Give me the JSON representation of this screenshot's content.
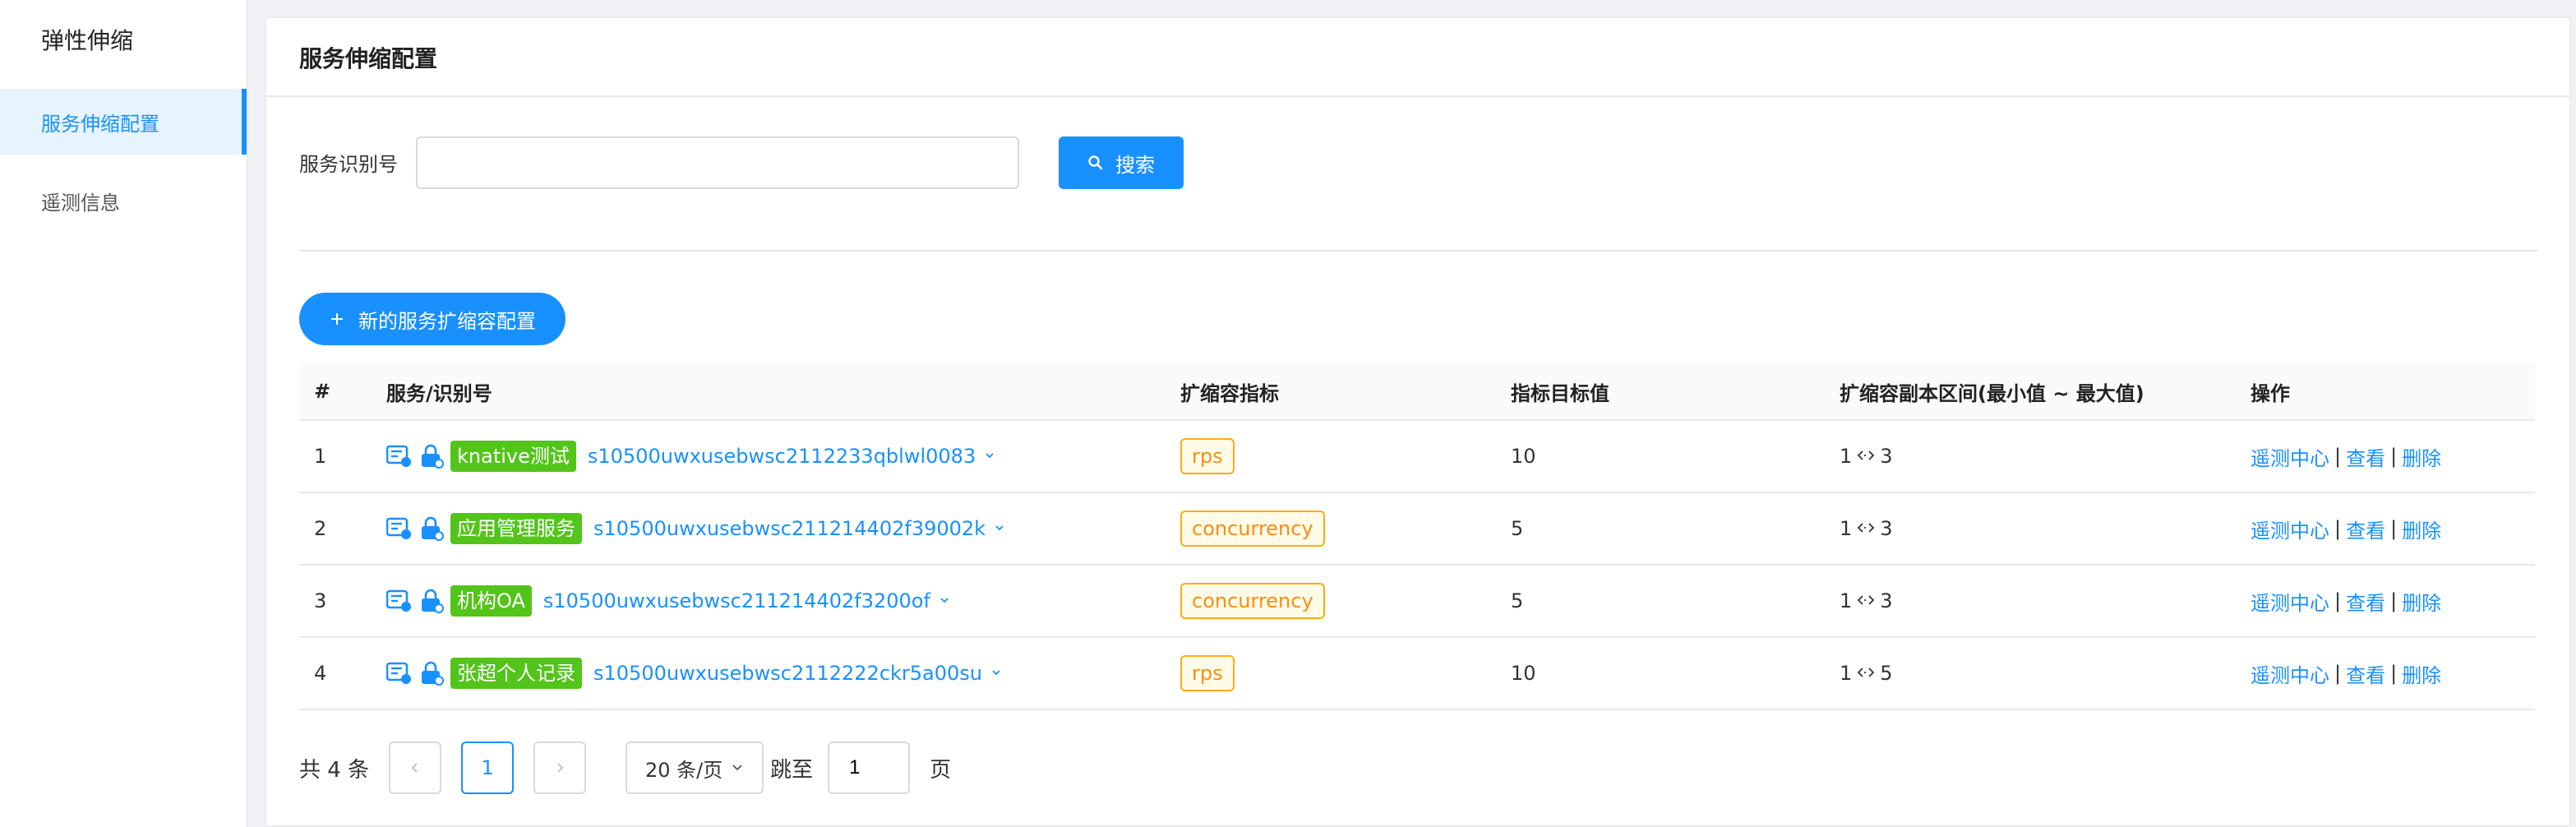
{
  "sidebar": {
    "title": "弹性伸缩",
    "items": [
      {
        "label": "服务伸缩配置",
        "active": true
      },
      {
        "label": "遥测信息",
        "active": false
      }
    ]
  },
  "page": {
    "title": "服务伸缩配置"
  },
  "search": {
    "label": "服务识别号",
    "value": "",
    "button_label": "搜索"
  },
  "actions": {
    "new_button_label": "新的服务扩缩容配置"
  },
  "table": {
    "columns": [
      "#",
      "服务/识别号",
      "扩缩容指标",
      "指标目标值",
      "扩缩容副本区间(最小值 ~ 最大值)",
      "操作"
    ],
    "rows": [
      {
        "index": "1",
        "service_name": "knative测试",
        "service_id": "s10500uwxusebwsc2112233qblwl0083",
        "metric": "rps",
        "target": "10",
        "min": "1",
        "max": "3"
      },
      {
        "index": "2",
        "service_name": "应用管理服务",
        "service_id": "s10500uwxusebwsc211214402f39002k",
        "metric": "concurrency",
        "target": "5",
        "min": "1",
        "max": "3"
      },
      {
        "index": "3",
        "service_name": "机构OA",
        "service_id": "s10500uwxusebwsc211214402f3200of",
        "metric": "concurrency",
        "target": "5",
        "min": "1",
        "max": "3"
      },
      {
        "index": "4",
        "service_name": "张超个人记录",
        "service_id": "s10500uwxusebwsc2112222ckr5a00su",
        "metric": "rps",
        "target": "10",
        "min": "1",
        "max": "5"
      }
    ],
    "ops": {
      "telemetry": "遥测中心",
      "view": "查看",
      "delete": "删除",
      "separator": "|"
    }
  },
  "pagination": {
    "total_text": "共 4 条",
    "current_page": "1",
    "page_size": "20 条/页",
    "jump_label": "跳至",
    "jump_value": "1",
    "jump_unit": "页"
  },
  "colors": {
    "primary": "#1890ff",
    "tag_green": "#52c41a",
    "metric_orange": "#fa8c16"
  },
  "icons": {
    "search": "search-icon",
    "plus": "plus-icon",
    "range": "left-right-arrow-icon",
    "expand": "chevron-down-icon"
  }
}
